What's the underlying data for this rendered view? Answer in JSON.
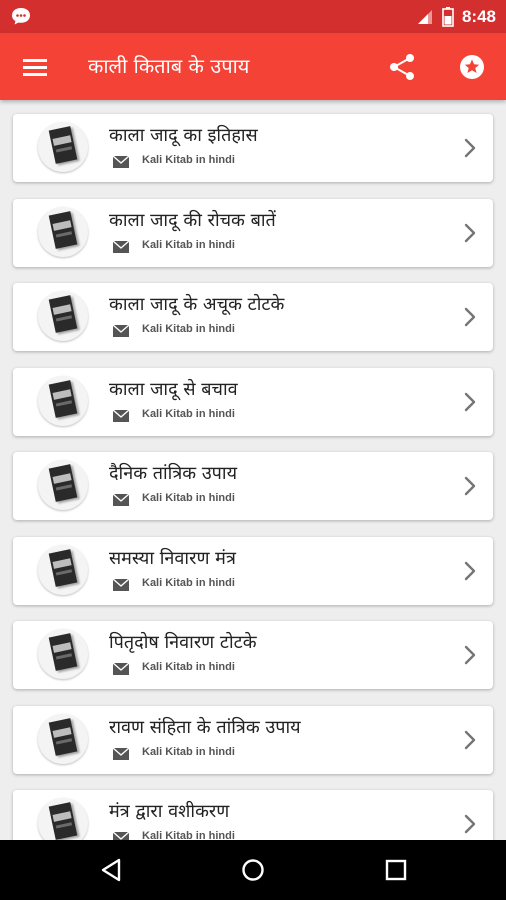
{
  "status_bar": {
    "time": "8:48",
    "icons": [
      "chat-bubble-icon",
      "signal-icon",
      "battery-icon"
    ]
  },
  "app_bar": {
    "title": "काली किताब के उपाय",
    "icons": [
      "menu-icon",
      "share-icon",
      "star-badge-icon"
    ]
  },
  "list": {
    "items": [
      {
        "title": "काला जादू का इतिहास",
        "subtitle": "Kali Kitab in hindi"
      },
      {
        "title": "काला जादू की रोचक बातें",
        "subtitle": "Kali Kitab in hindi"
      },
      {
        "title": "काला जादू के अचूक टोटके",
        "subtitle": "Kali Kitab in hindi"
      },
      {
        "title": "काला जादू से बचाव",
        "subtitle": "Kali Kitab in hindi"
      },
      {
        "title": "दैनिक तांत्रिक उपाय",
        "subtitle": "Kali Kitab in hindi"
      },
      {
        "title": "समस्या निवारण मंत्र",
        "subtitle": "Kali Kitab in hindi"
      },
      {
        "title": "पितृदोष निवारण टोटके",
        "subtitle": "Kali Kitab in hindi"
      },
      {
        "title": "रावण संहिता के तांत्रिक उपाय",
        "subtitle": "Kali Kitab in hindi"
      },
      {
        "title": "मंत्र द्वारा वशीकरण",
        "subtitle": "Kali Kitab in hindi"
      }
    ]
  },
  "colors": {
    "status_bar": "#d32f2f",
    "app_bar": "#f44336",
    "background": "#eeeeee",
    "card": "#ffffff",
    "nav_bar": "#000000"
  },
  "nav_bar": {
    "icons": [
      "back-icon",
      "home-icon",
      "recents-icon"
    ]
  }
}
